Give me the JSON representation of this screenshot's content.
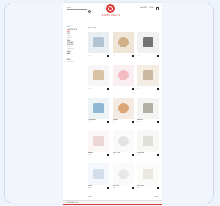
{
  "header": {
    "search_placeholder": "search",
    "brand": "KOPPA ATELIER"
  },
  "topnav": [
    "ACCOUNT",
    "LOGIN"
  ],
  "sidebar": {
    "heading": "SHOP",
    "categories": [
      "ALL PRODUCTS",
      "BABY",
      "KIDS",
      "HOME",
      "KITCHEN",
      "BATH",
      "TEXTILES",
      "LIGHTING",
      "TOYS",
      "STORAGE",
      "GIFTS",
      "SALE"
    ],
    "active_index": 1,
    "extra": [
      "ABOUT",
      "CONTACT"
    ]
  },
  "breadcrumb": "Home / Baby",
  "products": [
    {
      "name": "Ceramic Plate Set",
      "price": "€ 24",
      "swatch": "#e9eef3",
      "accent": "#9fb6c8"
    },
    {
      "name": "Wooden Blocks",
      "price": "€ 38",
      "swatch": "#efe6d7",
      "accent": "#c59c6c"
    },
    {
      "name": "Hanging Lamp",
      "price": "€ 89",
      "swatch": "#f1f1f1",
      "accent": "#4a4a4a"
    },
    {
      "name": "Baby Chair",
      "price": "€ 120",
      "swatch": "#f6f6f6",
      "accent": "#d0b08a"
    },
    {
      "name": "Nest Pillow",
      "price": "€ 64",
      "swatch": "#f9eef0",
      "accent": "#f0a8b6"
    },
    {
      "name": "Linen Basket",
      "price": "€ 42",
      "swatch": "#f3ede4",
      "accent": "#bfa68a"
    },
    {
      "name": "Color Spoons",
      "price": "€ 16",
      "swatch": "#eef3f6",
      "accent": "#6fa6c8"
    },
    {
      "name": "Play Mat",
      "price": "€ 55",
      "swatch": "#f3ebe1",
      "accent": "#d48d52"
    },
    {
      "name": "Hammock",
      "price": "€ 78",
      "swatch": "#f4f4f2",
      "accent": "#9a9a8e"
    },
    {
      "name": "Baby Bib",
      "price": "€ 12",
      "swatch": "#fbf7f7",
      "accent": "#e6c9c9"
    },
    {
      "name": "Muslin Cloth",
      "price": "€ 18",
      "swatch": "#fafafa",
      "accent": "#dcdcdc"
    },
    {
      "name": "Knit Blanket",
      "price": "€ 46",
      "swatch": "#f7f7f5",
      "accent": "#d8d8d0"
    },
    {
      "name": "Romper",
      "price": "€ 29",
      "swatch": "#f4f7fb",
      "accent": "#c7d6e6"
    },
    {
      "name": "Sleep Sack",
      "price": "€ 49",
      "swatch": "#fafafa",
      "accent": "#e2e2e2"
    },
    {
      "name": "Bath Towel",
      "price": "€ 27",
      "swatch": "#fbfbf9",
      "accent": "#e4e1d8"
    }
  ],
  "pager": {
    "prev": "PREV",
    "next": "NEXT"
  },
  "footer": "© KOPPA ATELIER"
}
